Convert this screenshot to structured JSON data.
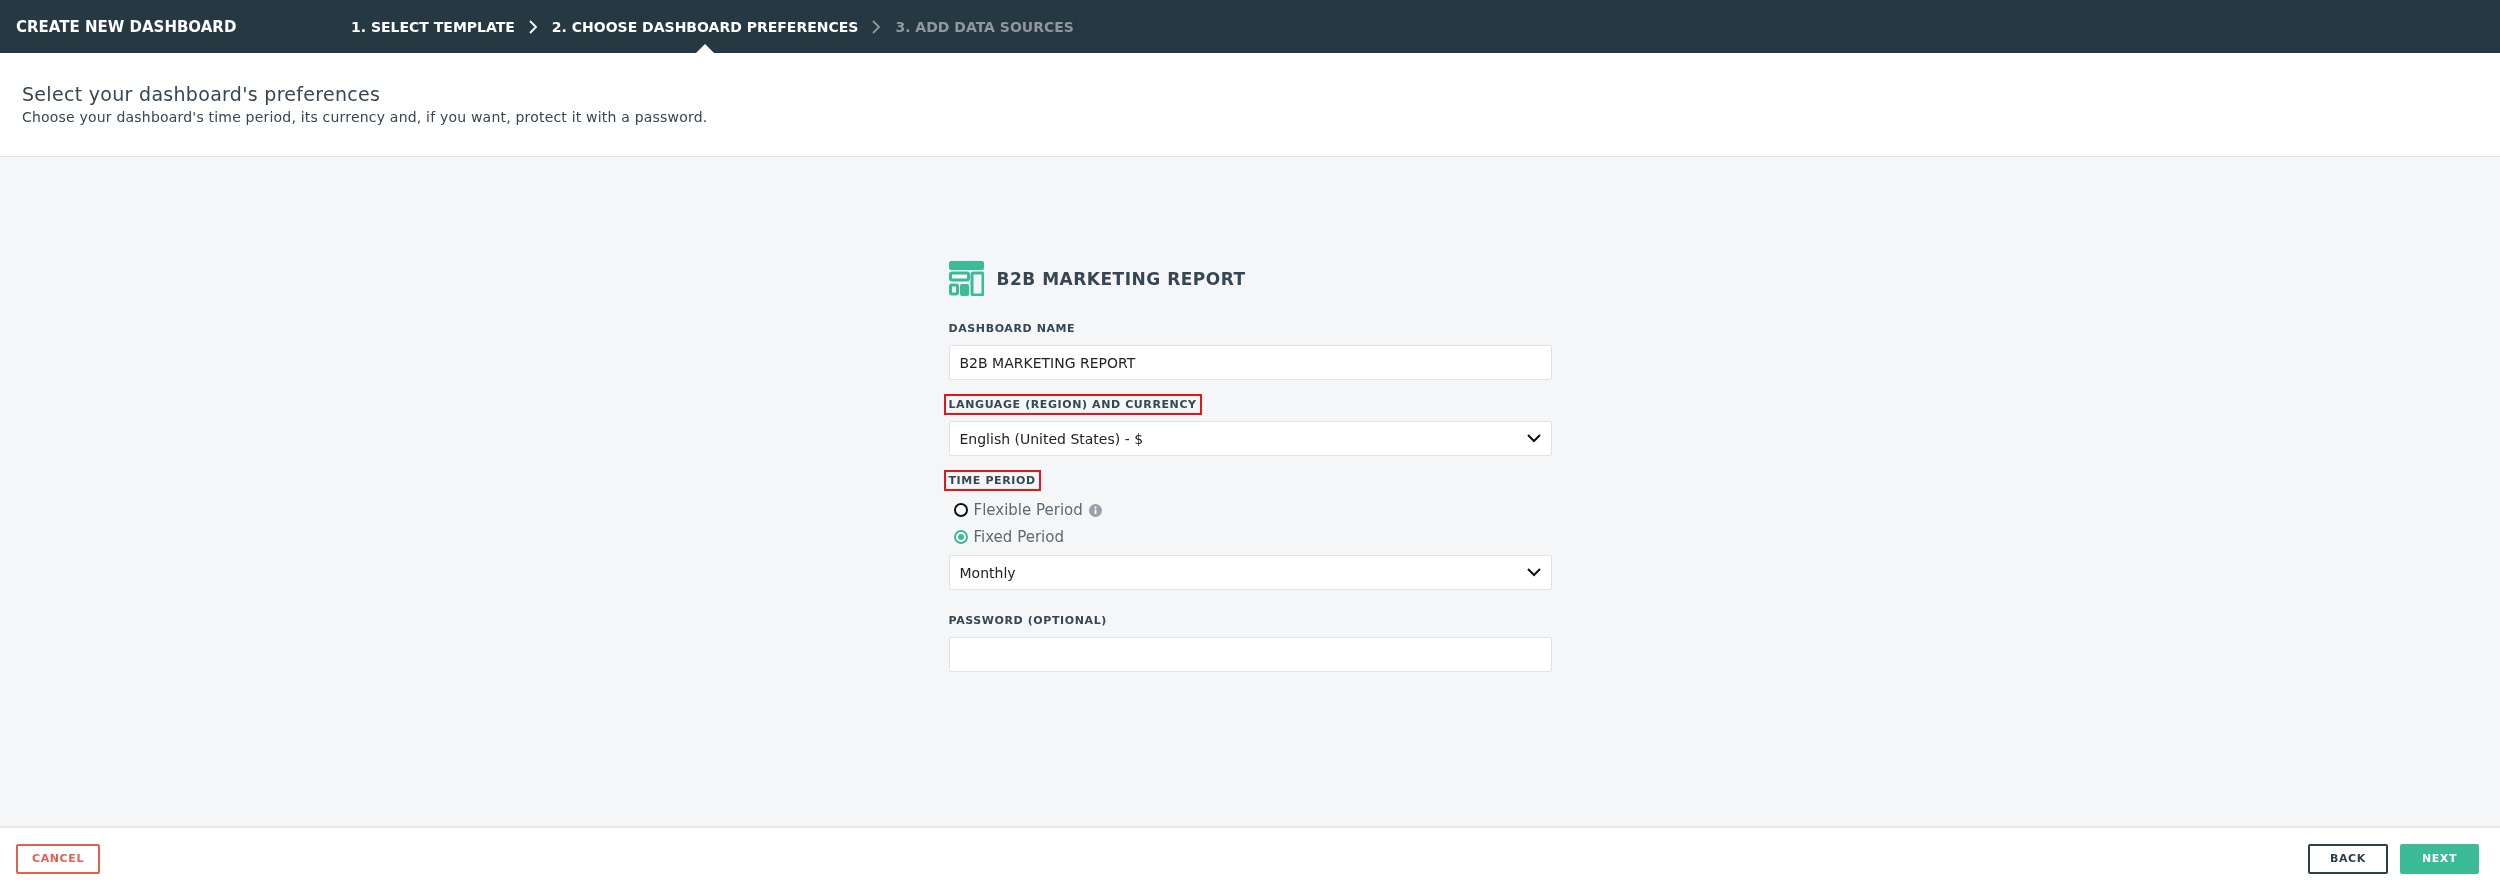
{
  "top_bar": {
    "title": "CREATE NEW DASHBOARD",
    "steps": [
      {
        "label": "1. SELECT TEMPLATE",
        "completed": true,
        "selected": false
      },
      {
        "label": "2. CHOOSE DASHBOARD PREFERENCES",
        "completed": false,
        "selected": true
      },
      {
        "label": "3. ADD DATA SOURCES",
        "completed": false,
        "selected": false
      }
    ]
  },
  "header": {
    "title": "Select your dashboard's preferences",
    "subtitle": "Choose your dashboard's time period, its currency and, if you want, protect it with a password."
  },
  "form": {
    "template_name": "B2B MARKETING REPORT",
    "fields": [
      {
        "kind": "text",
        "label": "DASHBOARD NAME",
        "highlighted": false,
        "value": "B2B MARKETING REPORT"
      },
      {
        "kind": "select",
        "label": "LANGUAGE (REGION) AND CURRENCY",
        "highlighted": true,
        "value": "English (United States) - $"
      },
      {
        "kind": "radio",
        "label": "TIME PERIOD",
        "highlighted": true,
        "options": [
          {
            "label": "Flexible Period",
            "selected": false,
            "info": true
          },
          {
            "label": "Fixed Period",
            "selected": true,
            "info": false
          }
        ],
        "value": "Monthly"
      },
      {
        "kind": "text",
        "label": "PASSWORD (OPTIONAL)",
        "highlighted": false
      }
    ]
  },
  "footer": {
    "buttons": [
      {
        "kind": "danger",
        "label": "CANCEL"
      },
      {
        "kind": "outline",
        "label": "BACK"
      },
      {
        "kind": "primary",
        "label": "NEXT"
      }
    ]
  }
}
